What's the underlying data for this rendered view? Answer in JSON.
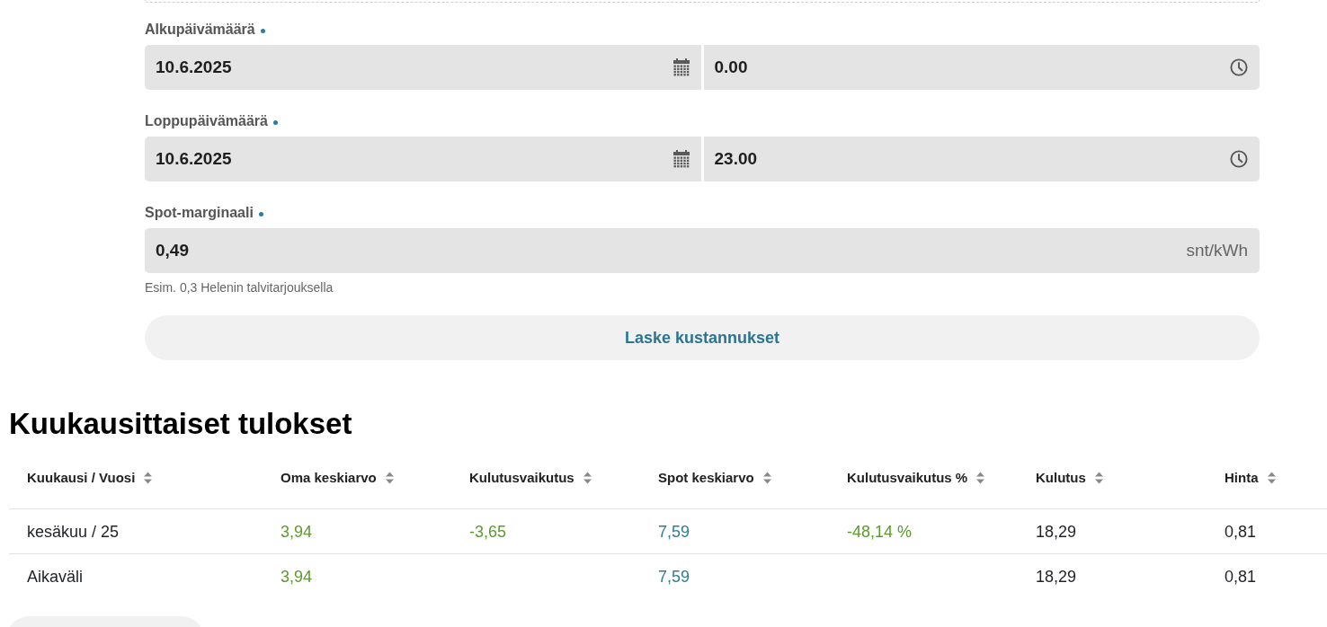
{
  "form": {
    "fields": [
      {
        "kind": "datetime",
        "label": "Alkupäivämäärä",
        "required": true,
        "date": "10.6.2025",
        "time": "0.00"
      },
      {
        "kind": "datetime",
        "label": "Loppupäivämäärä",
        "required": true,
        "date": "10.6.2025",
        "time": "23.00"
      },
      {
        "kind": "number",
        "label": "Spot-marginaali",
        "required": true,
        "value": "0,49",
        "unit": "snt/kWh",
        "help": "Esim. 0,3 Helenin talvitarjouksella"
      }
    ],
    "submit": "Laske kustannukset"
  },
  "results": {
    "title": "Kuukausittaiset tulokset",
    "columns": [
      {
        "label": "Kuukausi / Vuosi",
        "color": "#212529"
      },
      {
        "label": "Oma keskiarvo",
        "color": "#5b9a2c"
      },
      {
        "label": "Kulutusvaikutus",
        "color": "#5b9a2c"
      },
      {
        "label": "Spot keskiarvo",
        "color": "#2f7b9b"
      },
      {
        "label": "Kulutusvaikutus %",
        "color": "#5b9a2c"
      },
      {
        "label": "Kulutus",
        "color": "#212529"
      },
      {
        "label": "Hinta",
        "color": "#212529"
      }
    ],
    "rows": [
      [
        "kesäkuu / 25",
        "3,94",
        "-3,65",
        "7,59",
        "-48,14 %",
        "18,29",
        "0,81"
      ],
      [
        "Aikaväli",
        "3,94",
        null,
        "7,59",
        null,
        "18,29",
        "0,81"
      ]
    ]
  }
}
